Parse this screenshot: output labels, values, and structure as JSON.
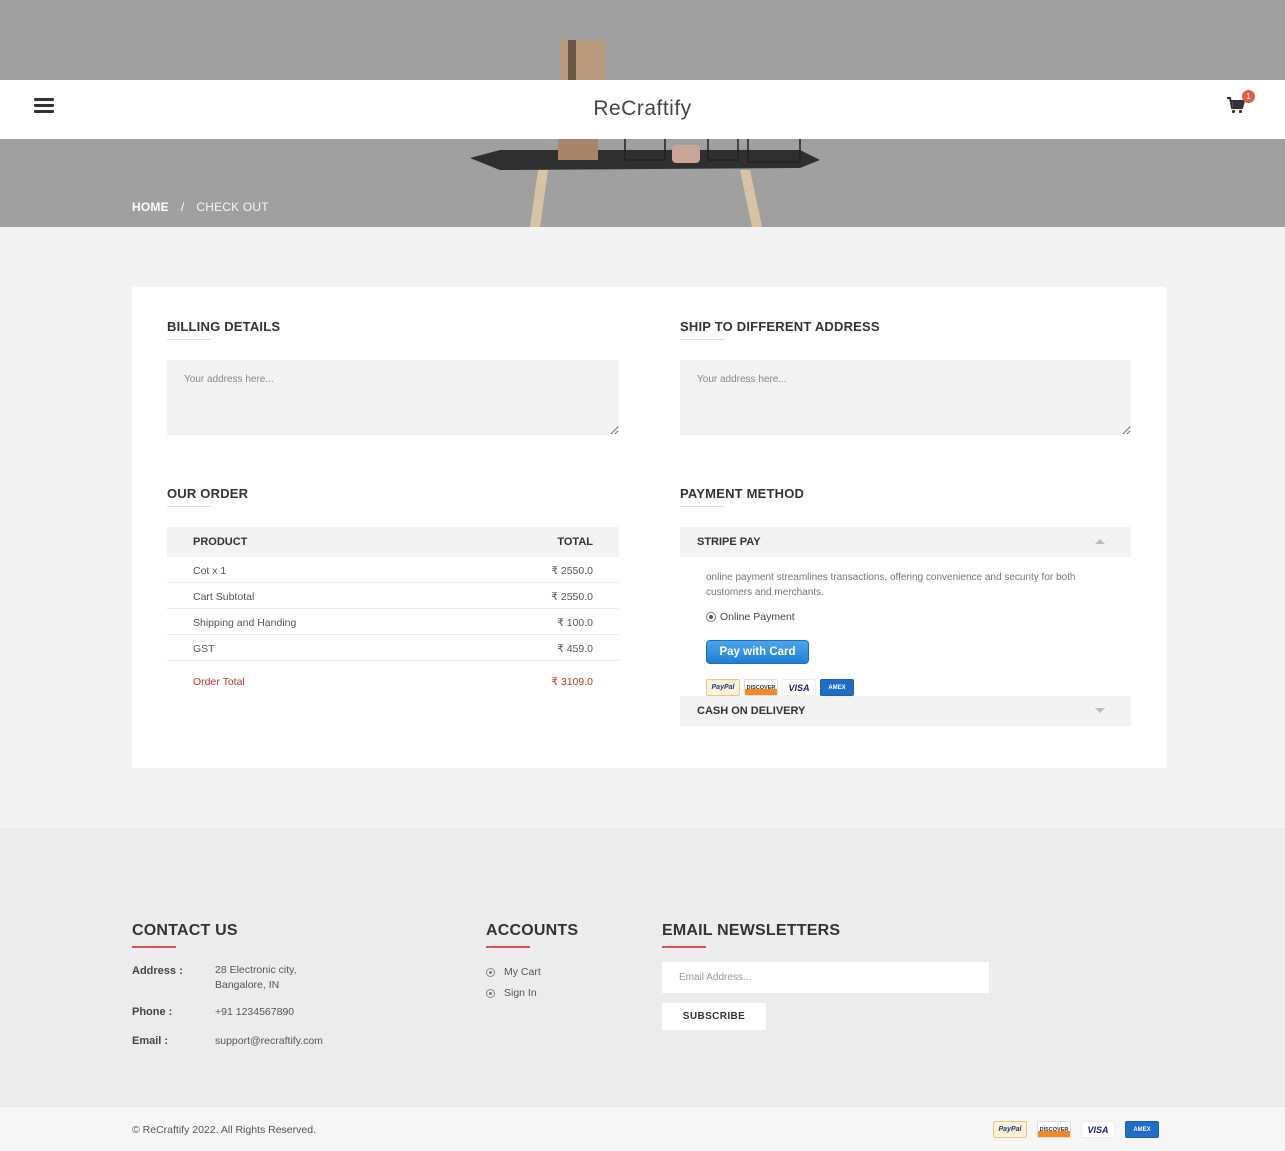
{
  "header": {
    "brand": "ReCraftify",
    "cart_count": "1"
  },
  "breadcrumb": {
    "home": "HOME",
    "separator": "/",
    "current": "CHECK OUT"
  },
  "billing": {
    "title": "BILLING DETAILS",
    "placeholder": "Your address here..."
  },
  "shipping": {
    "title": "SHIP TO DIFFERENT ADDRESS",
    "placeholder": "Your address here..."
  },
  "order": {
    "title": "OUR ORDER",
    "col_product": "PRODUCT",
    "col_total": "TOTAL",
    "rows": [
      {
        "label": "Cot x 1",
        "value": "₹ 2550.0"
      },
      {
        "label": "Cart Subtotal",
        "value": "₹ 2550.0"
      },
      {
        "label": "Shipping and Handing",
        "value": "₹ 100.0"
      },
      {
        "label": "GST",
        "value": "₹ 459.0"
      }
    ],
    "total_label": "Order Total",
    "total_value": "₹ 3109.0"
  },
  "payment": {
    "title": "PAYMENT METHOD",
    "stripe_label": "STRIPE PAY",
    "stripe_desc": "online payment streamlines transactions, offering convenience and security for both customers and merchants.",
    "online_label": "Online Payment",
    "pay_button": "Pay with Card",
    "cod_label": "CASH ON DELIVERY",
    "cards": [
      "PayPal",
      "DISCOVER",
      "VISA",
      "AMEX"
    ]
  },
  "footer": {
    "contact_title": "CONTACT US",
    "address_label": "Address :",
    "address_line1": "28 Electronic city,",
    "address_line2": "Bangalore, IN",
    "phone_label": "Phone :",
    "phone": "+91 1234567890",
    "email_label": "Email :",
    "email": "support@recraftify.com",
    "accounts_title": "ACCOUNTS",
    "accounts": [
      "My Cart",
      "Sign In"
    ],
    "newsletter_title": "EMAIL NEWSLETTERS",
    "email_placeholder": "Email Address...",
    "subscribe": "SUBSCRIBE",
    "copyright": "© ReCraftify 2022. All Rights Reserved."
  },
  "colors": {
    "accent": "#d9534f",
    "total": "#c0392b",
    "pay_button": "#1f7fd1"
  }
}
